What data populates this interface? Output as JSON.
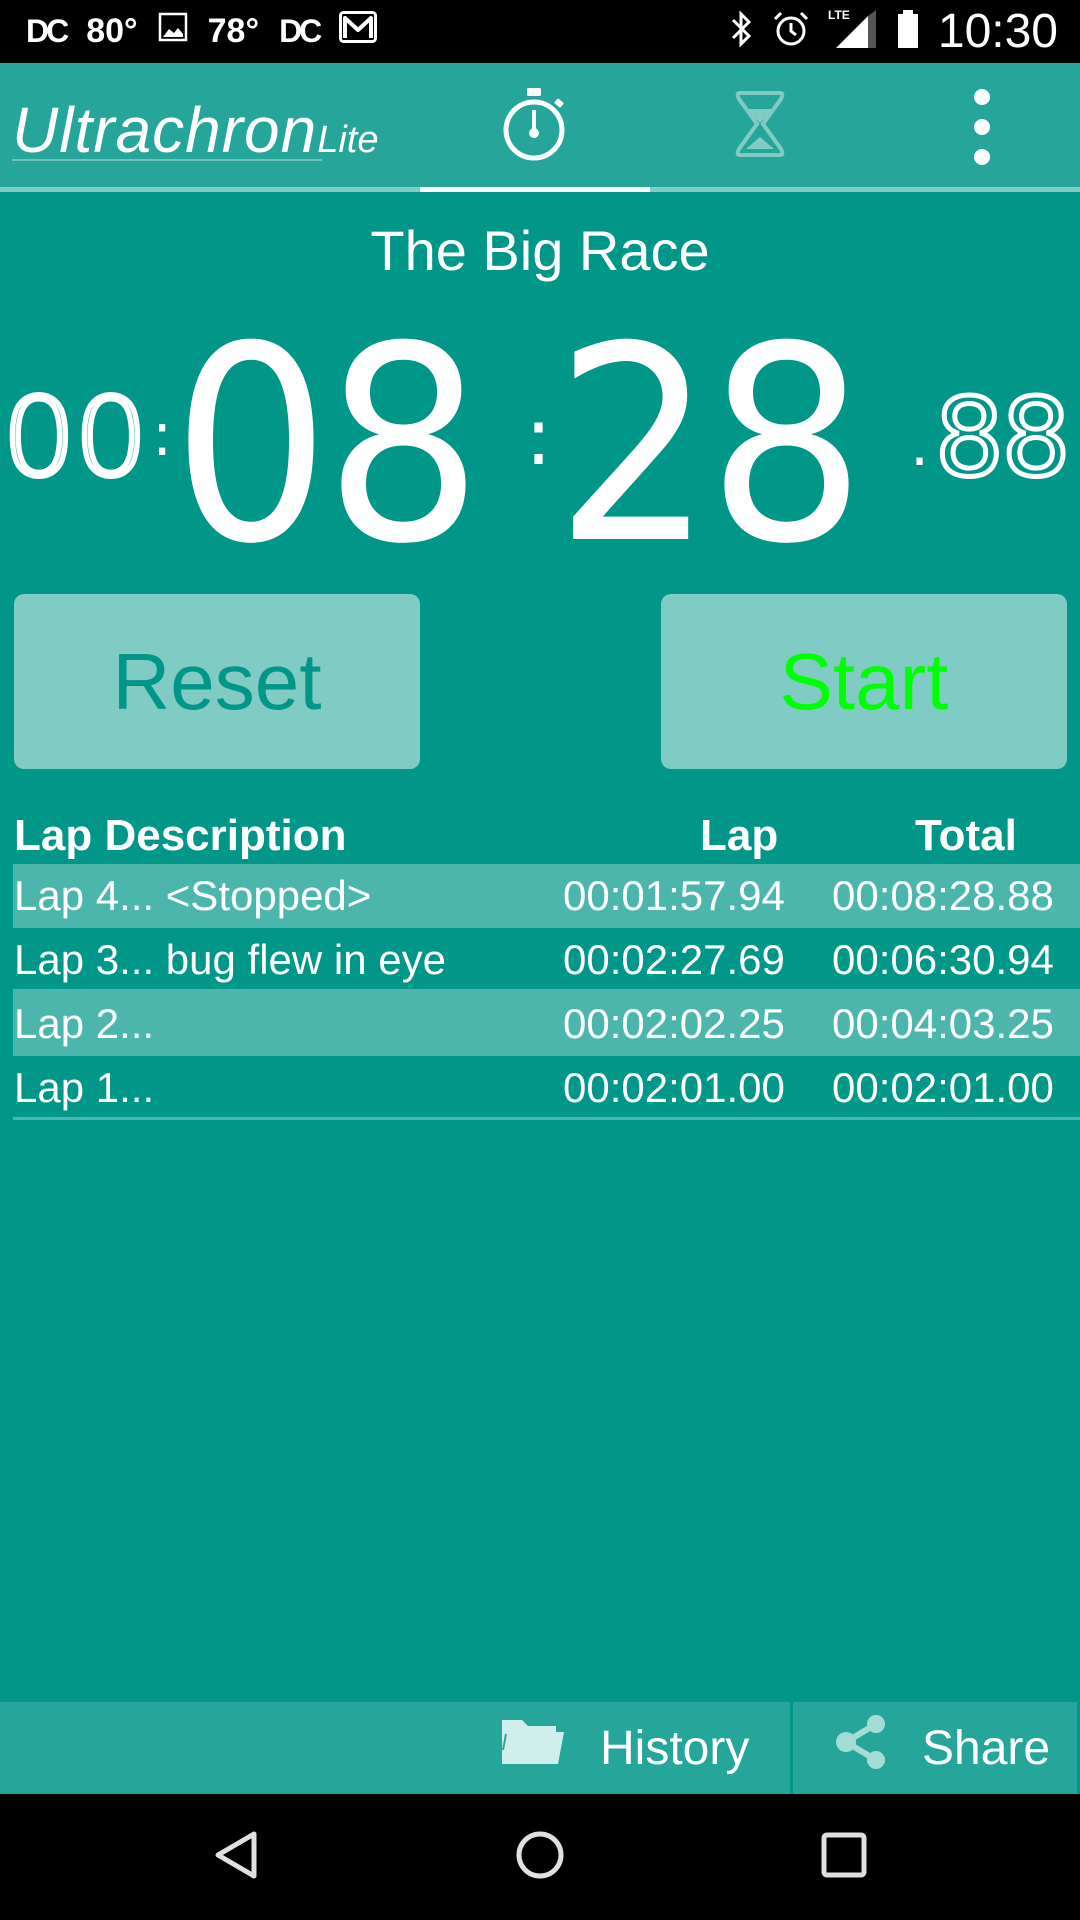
{
  "status_bar": {
    "left_items": [
      "DC",
      "80°",
      "image-icon",
      "78°",
      "DC",
      "gmail-icon"
    ],
    "dc1": "DC",
    "temp1": "80°",
    "temp2": "78°",
    "dc2": "DC",
    "network": "LTE",
    "time": "10:30"
  },
  "app_bar": {
    "logo_main": "Ultrachron",
    "logo_suffix": "Lite",
    "tabs": [
      {
        "name": "stopwatch",
        "icon": "stopwatch-icon",
        "selected": true
      },
      {
        "name": "timer",
        "icon": "hourglass-icon",
        "selected": false
      }
    ],
    "menu_icon": "more-vert-icon"
  },
  "race": {
    "title": "The Big Race"
  },
  "clock": {
    "hours": "00",
    "minutes": "08",
    "seconds": "28",
    "hundredths": "88",
    "sep1": ":",
    "sep2": ":",
    "sep3": "."
  },
  "buttons": {
    "reset": "Reset",
    "start": "Start"
  },
  "laps": {
    "headers": {
      "description": "Lap Description",
      "lap": "Lap",
      "total": "Total"
    },
    "rows": [
      {
        "description": "Lap 4... <Stopped>",
        "lap": "00:01:57.94",
        "total": "00:08:28.88"
      },
      {
        "description": "Lap 3... bug flew in eye",
        "lap": "00:02:27.69",
        "total": "00:06:30.94"
      },
      {
        "description": "Lap 2...",
        "lap": "00:02:02.25",
        "total": "00:04:03.25"
      },
      {
        "description": "Lap 1...",
        "lap": "00:02:01.00",
        "total": "00:02:01.00"
      }
    ]
  },
  "bottom_bar": {
    "history": "History",
    "share": "Share"
  },
  "colors": {
    "primary": "#009688",
    "app_bar": "#26a69a",
    "row_alt": "#4db6ac",
    "button_bg": "#80cbc4",
    "start_text": "#00ff00"
  }
}
